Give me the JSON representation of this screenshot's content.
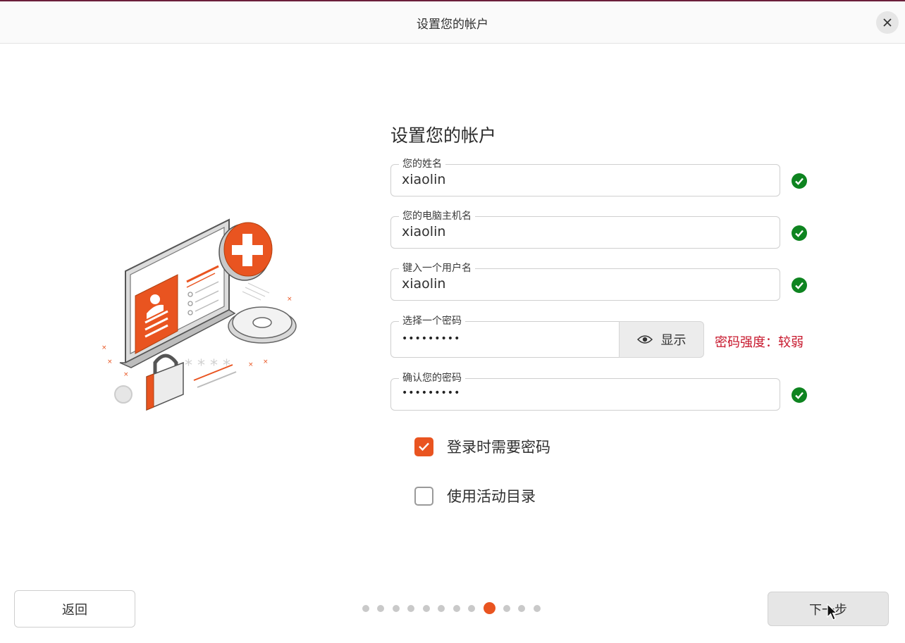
{
  "window": {
    "title": "设置您的帐户",
    "close_label": "×"
  },
  "form": {
    "heading": "设置您的帐户",
    "fields": [
      {
        "label": "您的姓名",
        "value": "xiaolin",
        "valid": true
      },
      {
        "label": "您的电脑主机名",
        "value": "xiaolin",
        "valid": true
      },
      {
        "label": "键入一个用户名",
        "value": "xiaolin",
        "valid": true
      },
      {
        "label": "选择一个密码",
        "value": "•••••••••",
        "show_label": "显示",
        "strength": "密码强度：较弱"
      },
      {
        "label": "确认您的密码",
        "value": "•••••••••",
        "valid": true
      }
    ],
    "checkboxes": [
      {
        "label": "登录时需要密码",
        "checked": true
      },
      {
        "label": "使用活动目录",
        "checked": false
      }
    ]
  },
  "footer": {
    "back_label": "返回",
    "next_label": "下一步",
    "progress": {
      "total_steps": 12,
      "current_step": 9
    }
  },
  "colors": {
    "accent": "#e95420",
    "valid": "#0e8420",
    "weak": "#c7162b"
  },
  "icons": [
    "close-icon",
    "check-circle-icon",
    "eye-icon",
    "checkbox-check-icon",
    "mouse-cursor-icon"
  ]
}
